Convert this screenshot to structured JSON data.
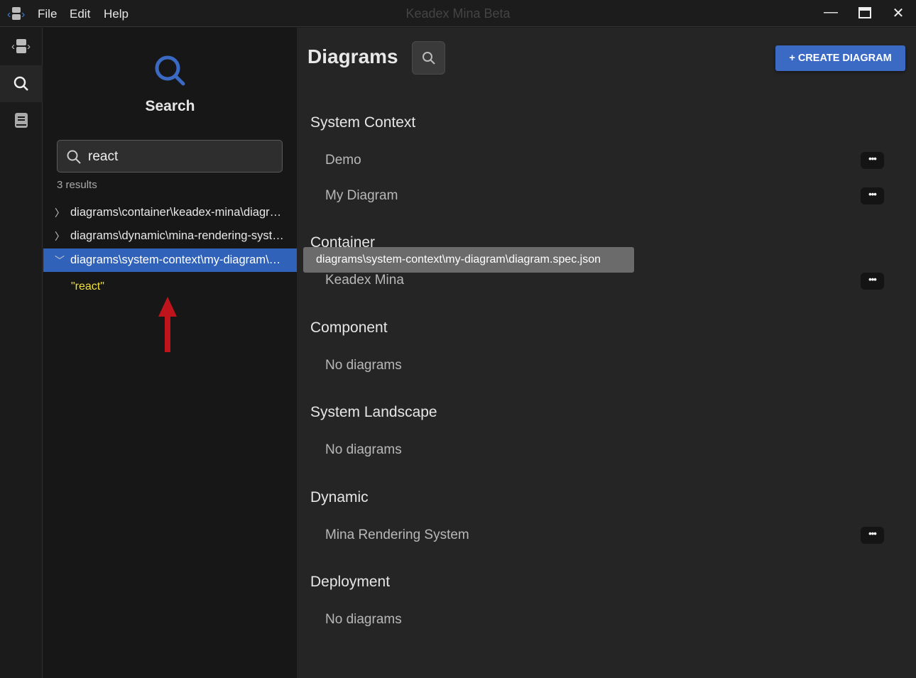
{
  "app": {
    "title": "Keadex Mina Beta",
    "menu": [
      "File",
      "Edit",
      "Help"
    ]
  },
  "sidebar": {
    "heading": "Search",
    "search_value": "react",
    "results_count": "3 results",
    "results": [
      {
        "path": "diagrams\\container\\keadex-mina\\diagram.spec.json",
        "expanded": false
      },
      {
        "path": "diagrams\\dynamic\\mina-rendering-system\\diagram.spec.json",
        "expanded": false
      },
      {
        "path": "diagrams\\system-context\\my-diagram\\diagram.spec.json",
        "expanded": true,
        "selected": true,
        "match": "\"react\""
      }
    ]
  },
  "tooltip": "diagrams\\system-context\\my-diagram\\diagram.spec.json",
  "main": {
    "title": "Diagrams",
    "create_label": "+ CREATE DIAGRAM",
    "accent": "#3a6ac4",
    "sections": [
      {
        "title": "System Context",
        "items": [
          "Demo",
          "My Diagram"
        ]
      },
      {
        "title": "Container",
        "items": [
          "Keadex Mina"
        ]
      },
      {
        "title": "Component",
        "items": [
          "No diagrams"
        ]
      },
      {
        "title": "System Landscape",
        "items": [
          "No diagrams"
        ]
      },
      {
        "title": "Dynamic",
        "items": [
          "Mina Rendering System"
        ]
      },
      {
        "title": "Deployment",
        "items": [
          "No diagrams"
        ]
      }
    ],
    "more_label": "•••"
  }
}
